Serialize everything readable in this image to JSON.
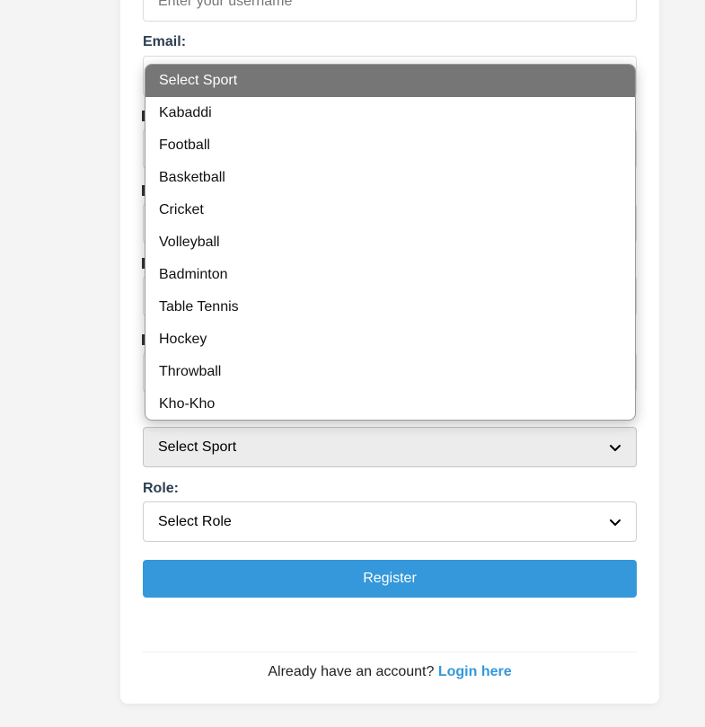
{
  "form": {
    "username": {
      "placeholder": "Enter your username",
      "value": ""
    },
    "email": {
      "label": "Email:"
    },
    "sport": {
      "selected": "Select Sport",
      "options": [
        "Select Sport",
        "Kabaddi",
        "Football",
        "Basketball",
        "Cricket",
        "Volleyball",
        "Badminton",
        "Table Tennis",
        "Hockey",
        "Throwball",
        "Kho-Kho"
      ]
    },
    "role": {
      "label": "Role:",
      "selected": "Select Role"
    },
    "register_label": "Register"
  },
  "footer": {
    "prompt": "Already have an account?",
    "login_link": "Login here"
  },
  "colors": {
    "accent": "#3498db",
    "label": "#2c3e50",
    "selected_option": "#767676",
    "background": "#f4f4f4"
  },
  "icons": {
    "select_arrow": "chevron-down-icon"
  }
}
